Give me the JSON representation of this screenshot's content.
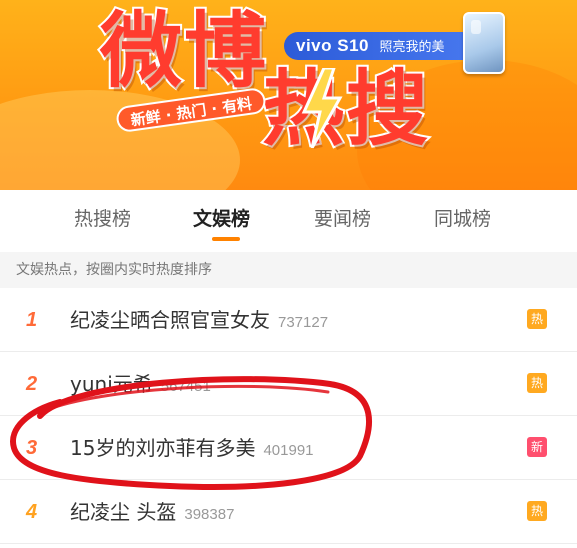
{
  "banner": {
    "title_part1": "微博",
    "title_part2": "热搜",
    "slogan": "新鲜 · 热门 · 有料",
    "ad_brand": "vivo S10",
    "ad_text": "照亮我的美",
    "colors": {
      "background": "#ff9b12",
      "title": "#ff3c2e",
      "ad": "#2c5bd8"
    }
  },
  "tabs": [
    {
      "label": "热搜榜",
      "active": false
    },
    {
      "label": "文娱榜",
      "active": true
    },
    {
      "label": "要闻榜",
      "active": false
    },
    {
      "label": "同城榜",
      "active": false
    }
  ],
  "info_bar": {
    "text": "文娱热点，按圈内实时热度排序"
  },
  "list": [
    {
      "rank": "1",
      "title": "纪凌尘晒合照官宣女友",
      "heat": "737127",
      "badge": "热",
      "badge_type": "hot"
    },
    {
      "rank": "2",
      "title": "yuni元希",
      "heat": "567451",
      "badge": "热",
      "badge_type": "hot"
    },
    {
      "rank": "3",
      "title": "15岁的刘亦菲有多美",
      "heat": "401991",
      "badge": "新",
      "badge_type": "new"
    },
    {
      "rank": "4",
      "title": "纪凌尘 头盔",
      "heat": "398387",
      "badge": "热",
      "badge_type": "hot"
    }
  ],
  "colors": {
    "accent": "#ff8200",
    "rank": "#ff6a38",
    "annotation": "#e0121a"
  }
}
